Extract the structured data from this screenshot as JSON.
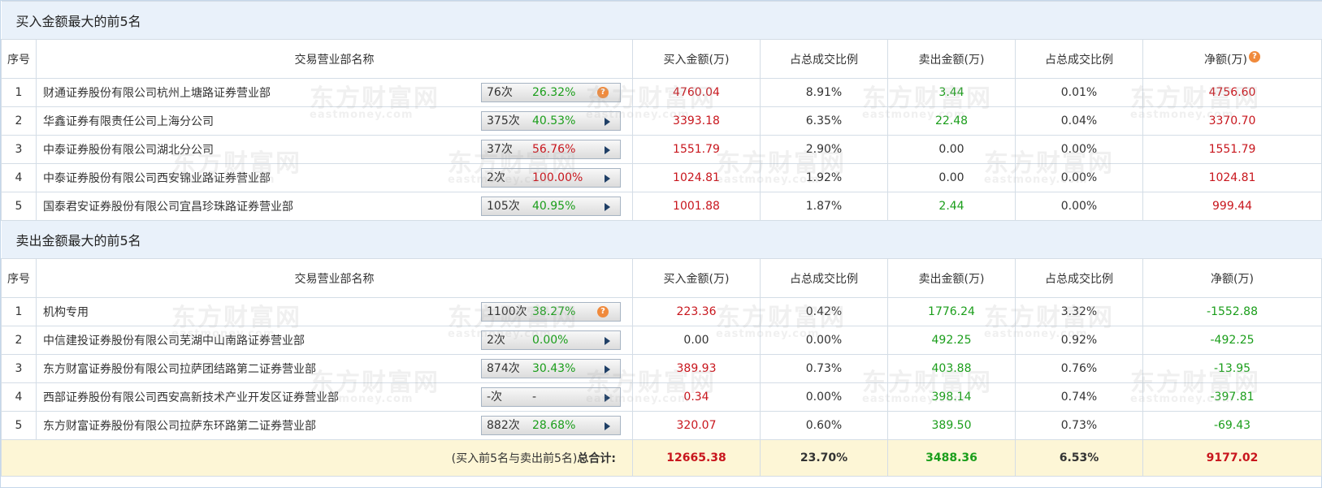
{
  "buy_section": {
    "title": "买入金额最大的前5名",
    "headers": {
      "idx": "序号",
      "name": "交易营业部名称",
      "buy": "买入金额(万)",
      "buy_ratio": "占总成交比例",
      "sell": "卖出金额(万)",
      "sell_ratio": "占总成交比例",
      "net": "净额(万)"
    },
    "rows": [
      {
        "idx": "1",
        "name": "财通证券股份有限公司杭州上塘路证券营业部",
        "count": "76次",
        "pct": "26.32%",
        "pct_color": "green",
        "icon": "question-icon",
        "buy": "4760.04",
        "buy_ratio": "8.91%",
        "sell": "3.44",
        "sell_ratio": "0.01%",
        "net": "4756.60"
      },
      {
        "idx": "2",
        "name": "华鑫证券有限责任公司上海分公司",
        "count": "375次",
        "pct": "40.53%",
        "pct_color": "green",
        "icon": "play-arrow-icon",
        "buy": "3393.18",
        "buy_ratio": "6.35%",
        "sell": "22.48",
        "sell_ratio": "0.04%",
        "net": "3370.70"
      },
      {
        "idx": "3",
        "name": "中泰证券股份有限公司湖北分公司",
        "count": "37次",
        "pct": "56.76%",
        "pct_color": "red",
        "icon": "play-arrow-icon",
        "buy": "1551.79",
        "buy_ratio": "2.90%",
        "sell": "0.00",
        "sell_ratio": "0.00%",
        "net": "1551.79"
      },
      {
        "idx": "4",
        "name": "中泰证券股份有限公司西安锦业路证券营业部",
        "count": "2次",
        "pct": "100.00%",
        "pct_color": "red",
        "icon": "play-arrow-icon",
        "buy": "1024.81",
        "buy_ratio": "1.92%",
        "sell": "0.00",
        "sell_ratio": "0.00%",
        "net": "1024.81"
      },
      {
        "idx": "5",
        "name": "国泰君安证券股份有限公司宜昌珍珠路证券营业部",
        "count": "105次",
        "pct": "40.95%",
        "pct_color": "green",
        "icon": "play-arrow-icon",
        "buy": "1001.88",
        "buy_ratio": "1.87%",
        "sell": "2.44",
        "sell_ratio": "0.00%",
        "net": "999.44"
      }
    ]
  },
  "sell_section": {
    "title": "卖出金额最大的前5名",
    "headers": {
      "idx": "序号",
      "name": "交易营业部名称",
      "buy": "买入金额(万)",
      "buy_ratio": "占总成交比例",
      "sell": "卖出金额(万)",
      "sell_ratio": "占总成交比例",
      "net": "净额(万)"
    },
    "rows": [
      {
        "idx": "1",
        "name": "机构专用",
        "count": "1100次",
        "pct": "38.27%",
        "pct_color": "green",
        "icon": "question-icon",
        "buy": "223.36",
        "buy_ratio": "0.42%",
        "sell": "1776.24",
        "sell_ratio": "3.32%",
        "net": "-1552.88"
      },
      {
        "idx": "2",
        "name": "中信建投证券股份有限公司芜湖中山南路证券营业部",
        "count": "2次",
        "pct": "0.00%",
        "pct_color": "green",
        "icon": "play-arrow-icon",
        "buy": "0.00",
        "buy_ratio": "0.00%",
        "sell": "492.25",
        "sell_ratio": "0.92%",
        "net": "-492.25"
      },
      {
        "idx": "3",
        "name": "东方财富证券股份有限公司拉萨团结路第二证券营业部",
        "count": "874次",
        "pct": "30.43%",
        "pct_color": "green",
        "icon": "play-arrow-icon",
        "buy": "389.93",
        "buy_ratio": "0.73%",
        "sell": "403.88",
        "sell_ratio": "0.76%",
        "net": "-13.95"
      },
      {
        "idx": "4",
        "name": "西部证券股份有限公司西安高新技术产业开发区证券营业部",
        "count": "-次",
        "pct": "-",
        "pct_color": "black",
        "icon": "play-arrow-icon",
        "buy": "0.34",
        "buy_ratio": "0.00%",
        "sell": "398.14",
        "sell_ratio": "0.74%",
        "net": "-397.81"
      },
      {
        "idx": "5",
        "name": "东方财富证券股份有限公司拉萨东环路第二证券营业部",
        "count": "882次",
        "pct": "28.68%",
        "pct_color": "green",
        "icon": "play-arrow-icon",
        "buy": "320.07",
        "buy_ratio": "0.60%",
        "sell": "389.50",
        "sell_ratio": "0.73%",
        "net": "-69.43"
      }
    ]
  },
  "total": {
    "label_prefix": "(买入前5名与卖出前5名)",
    "label_bold": "总合计:",
    "buy": "12665.38",
    "buy_ratio": "23.70%",
    "sell": "3488.36",
    "sell_ratio": "6.53%",
    "net": "9177.02"
  },
  "header_help_icon": "question-icon",
  "watermark": {
    "cn": "东方财富网",
    "en": "eastmoney.com"
  },
  "colors": {
    "buy_red": "#c8161d",
    "sell_green": "#1b9e1b",
    "section_bg": "#e9f1fa",
    "total_bg": "#fdf6d6",
    "help_orange": "#f08a3c"
  }
}
